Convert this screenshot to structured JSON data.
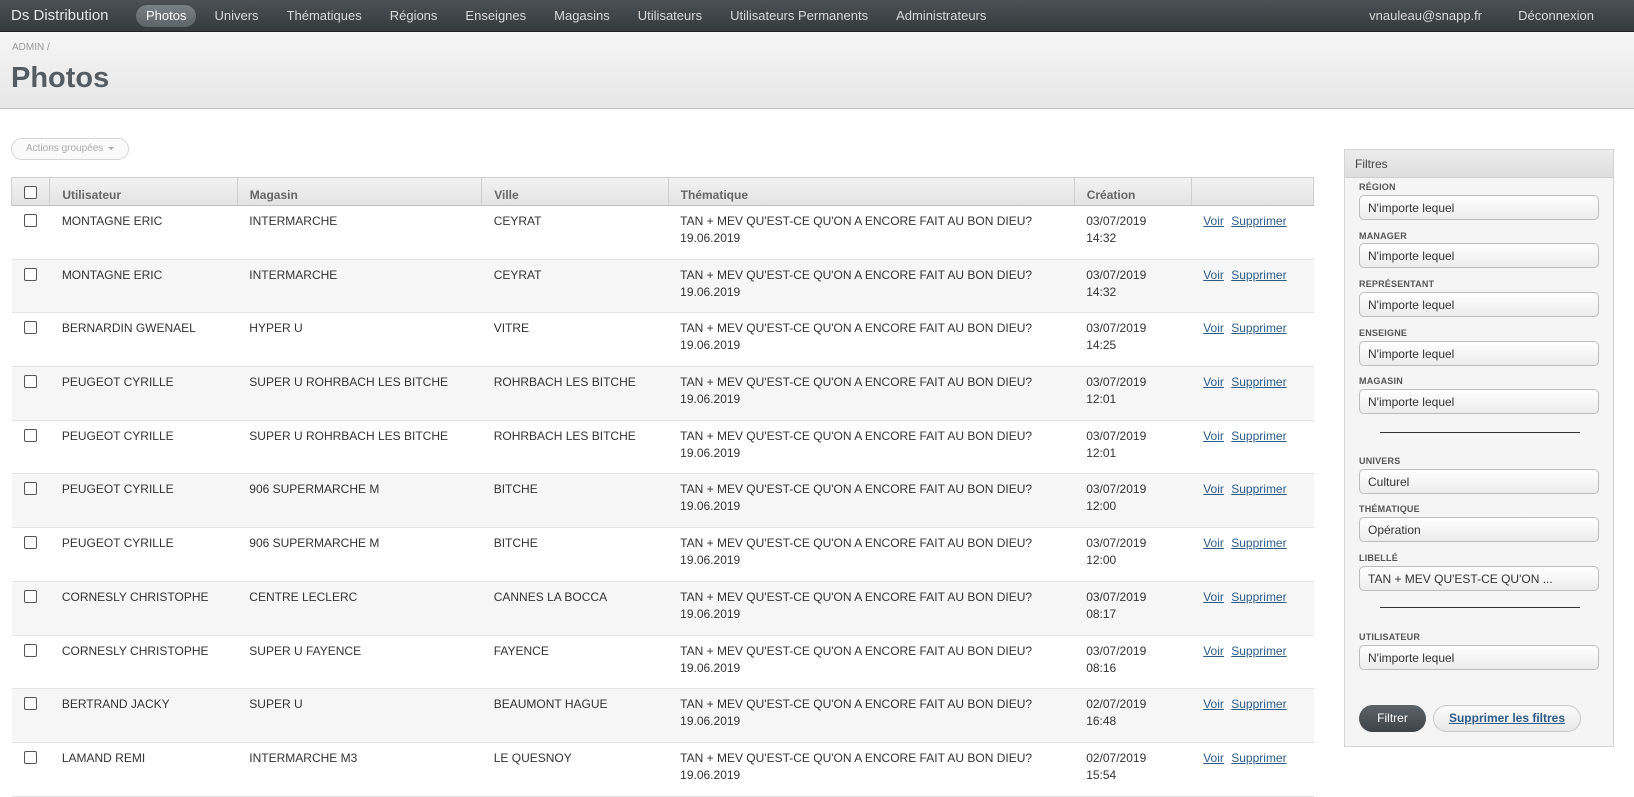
{
  "app": {
    "brand": "Ds Distribution"
  },
  "nav": {
    "items": [
      "Photos",
      "Univers",
      "Thématiques",
      "Régions",
      "Enseignes",
      "Magasins",
      "Utilisateurs",
      "Utilisateurs Permanents",
      "Administrateurs"
    ],
    "active": "Photos",
    "user_email": "vnauleau@snapp.fr",
    "logout": "Déconnexion"
  },
  "breadcrumb": {
    "root": "ADMIN",
    "sep": "/"
  },
  "page": {
    "title": "Photos"
  },
  "actions": {
    "label": "Actions groupées"
  },
  "table": {
    "columns": [
      "Utilisateur",
      "Magasin",
      "Ville",
      "Thématique",
      "Création"
    ],
    "link_view": "Voir",
    "link_delete": "Supprimer",
    "rows": [
      {
        "user": "MONTAGNE ERIC",
        "store": "INTERMARCHE",
        "city": "CEYRAT",
        "theme": "TAN + MEV QU'EST-CE QU'ON A ENCORE FAIT AU BON DIEU?",
        "theme_date": "19.06.2019",
        "date": "03/07/2019",
        "time": "14:32"
      },
      {
        "user": "MONTAGNE ERIC",
        "store": "INTERMARCHE",
        "city": "CEYRAT",
        "theme": "TAN + MEV QU'EST-CE QU'ON A ENCORE FAIT AU BON DIEU?",
        "theme_date": "19.06.2019",
        "date": "03/07/2019",
        "time": "14:32"
      },
      {
        "user": "BERNARDIN GWENAEL",
        "store": "HYPER U",
        "city": "VITRE",
        "theme": "TAN + MEV QU'EST-CE QU'ON A ENCORE FAIT AU BON DIEU?",
        "theme_date": "19.06.2019",
        "date": "03/07/2019",
        "time": "14:25"
      },
      {
        "user": "PEUGEOT CYRILLE",
        "store": "SUPER U ROHRBACH LES BITCHE",
        "city": "ROHRBACH LES BITCHE",
        "theme": "TAN + MEV QU'EST-CE QU'ON A ENCORE FAIT AU BON DIEU?",
        "theme_date": "19.06.2019",
        "date": "03/07/2019",
        "time": "12:01"
      },
      {
        "user": "PEUGEOT CYRILLE",
        "store": "SUPER U ROHRBACH LES BITCHE",
        "city": "ROHRBACH LES BITCHE",
        "theme": "TAN + MEV QU'EST-CE QU'ON A ENCORE FAIT AU BON DIEU?",
        "theme_date": "19.06.2019",
        "date": "03/07/2019",
        "time": "12:01"
      },
      {
        "user": "PEUGEOT CYRILLE",
        "store": "906 SUPERMARCHE M",
        "city": "BITCHE",
        "theme": "TAN + MEV QU'EST-CE QU'ON A ENCORE FAIT AU BON DIEU?",
        "theme_date": "19.06.2019",
        "date": "03/07/2019",
        "time": "12:00"
      },
      {
        "user": "PEUGEOT CYRILLE",
        "store": "906 SUPERMARCHE M",
        "city": "BITCHE",
        "theme": "TAN + MEV QU'EST-CE QU'ON A ENCORE FAIT AU BON DIEU?",
        "theme_date": "19.06.2019",
        "date": "03/07/2019",
        "time": "12:00"
      },
      {
        "user": "CORNESLY CHRISTOPHE",
        "store": "CENTRE LECLERC",
        "city": "CANNES LA BOCCA",
        "theme": "TAN + MEV QU'EST-CE QU'ON A ENCORE FAIT AU BON DIEU?",
        "theme_date": "19.06.2019",
        "date": "03/07/2019",
        "time": "08:17"
      },
      {
        "user": "CORNESLY CHRISTOPHE",
        "store": "SUPER U FAYENCE",
        "city": "FAYENCE",
        "theme": "TAN + MEV QU'EST-CE QU'ON A ENCORE FAIT AU BON DIEU?",
        "theme_date": "19.06.2019",
        "date": "03/07/2019",
        "time": "08:16"
      },
      {
        "user": "BERTRAND JACKY",
        "store": "SUPER U",
        "city": "BEAUMONT HAGUE",
        "theme": "TAN + MEV QU'EST-CE QU'ON A ENCORE FAIT AU BON DIEU?",
        "theme_date": "19.06.2019",
        "date": "02/07/2019",
        "time": "16:48"
      },
      {
        "user": "LAMAND REMI",
        "store": "INTERMARCHE M3",
        "city": "LE QUESNOY",
        "theme": "TAN + MEV QU'EST-CE QU'ON A ENCORE FAIT AU BON DIEU?",
        "theme_date": "19.06.2019",
        "date": "02/07/2019",
        "time": "15:54"
      }
    ]
  },
  "filters": {
    "title": "Filtres",
    "region": {
      "label": "RÉGION",
      "value": "N'importe lequel"
    },
    "manager": {
      "label": "MANAGER",
      "value": "N'importe lequel"
    },
    "representant": {
      "label": "REPRÉSENTANT",
      "value": "N'importe lequel"
    },
    "enseigne": {
      "label": "ENSEIGNE",
      "value": "N'importe lequel"
    },
    "magasin": {
      "label": "MAGASIN",
      "value": "N'importe lequel"
    },
    "univers": {
      "label": "UNIVERS",
      "value": "Culturel"
    },
    "thematique": {
      "label": "THÉMATIQUE",
      "value": "Opération"
    },
    "libelle": {
      "label": "LIBELLÉ",
      "value": "TAN + MEV QU'EST-CE QU'ON ..."
    },
    "utilisateur": {
      "label": "UTILISATEUR",
      "value": "N'importe lequel"
    },
    "submit": "Filtrer",
    "clear": "Supprimer les filtres"
  }
}
